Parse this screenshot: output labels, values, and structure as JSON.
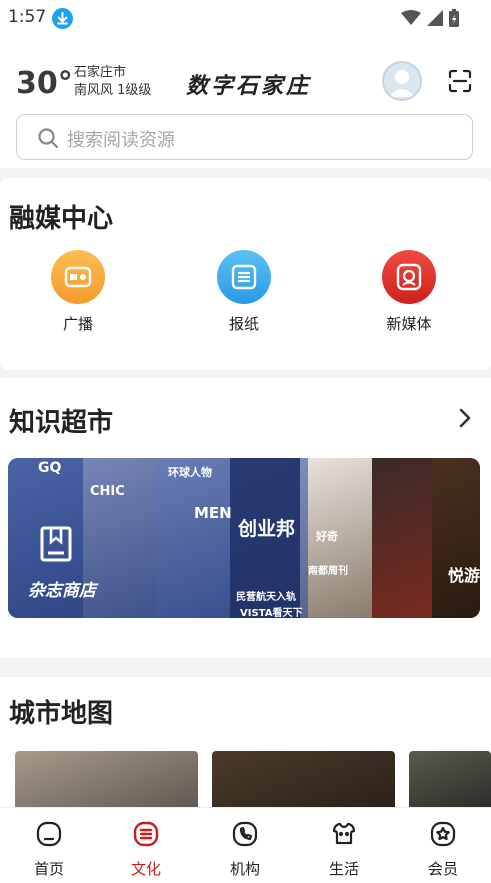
{
  "status_bar": {
    "time": "1:57"
  },
  "header": {
    "temperature": "30°",
    "city": "石家庄市",
    "weather": "南风风 1级级",
    "brand": "数字石家庄"
  },
  "search": {
    "placeholder": "搜索阅读资源"
  },
  "media_center": {
    "title": "融媒中心",
    "items": [
      {
        "label": "广播",
        "icon": "radio-icon",
        "color": "#f7a63a"
      },
      {
        "label": "报纸",
        "icon": "newspaper-icon",
        "color": "#3aa7ea"
      },
      {
        "label": "新媒体",
        "icon": "new-media-icon",
        "color": "#e0322d"
      }
    ]
  },
  "knowledge_market": {
    "title": "知识超市",
    "banner": {
      "label": "杂志商店",
      "magazine_texts": [
        "GQ",
        "环球人物",
        "CHIC",
        "创业邦",
        "MEN",
        "南都周刊",
        "悦游",
        "民营航天入轨",
        "VISTA看天下",
        "好奇"
      ]
    }
  },
  "city_map": {
    "title": "城市地图"
  },
  "tabbar": {
    "tabs": [
      {
        "label": "首页",
        "icon": "home-icon",
        "active": false
      },
      {
        "label": "文化",
        "icon": "culture-icon",
        "active": true
      },
      {
        "label": "机构",
        "icon": "phone-icon",
        "active": false
      },
      {
        "label": "生活",
        "icon": "life-icon",
        "active": false
      },
      {
        "label": "会员",
        "icon": "member-icon",
        "active": false
      }
    ]
  },
  "colors": {
    "accent": "#c81e1e",
    "banner_blue": "#2c4a9a"
  }
}
